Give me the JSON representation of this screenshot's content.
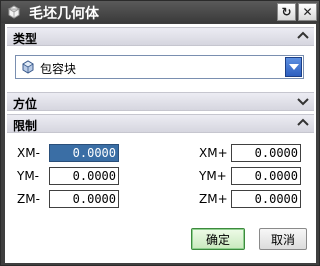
{
  "window": {
    "title": "毛坯几何体",
    "reset_glyph": "↻",
    "close_glyph": "✕"
  },
  "sections": {
    "type": {
      "label": "类型",
      "state": "expanded"
    },
    "orientation": {
      "label": "方位",
      "state": "collapsed"
    },
    "limits": {
      "label": "限制",
      "state": "expanded"
    }
  },
  "type_select": {
    "value": "包容块",
    "icon": "block-icon"
  },
  "limits": {
    "left": [
      {
        "label": "XM-",
        "value": "0.0000"
      },
      {
        "label": "YM-",
        "value": "0.0000"
      },
      {
        "label": "ZM-",
        "value": "0.0000"
      }
    ],
    "right": [
      {
        "label": "XM+",
        "value": "0.0000"
      },
      {
        "label": "YM+",
        "value": "0.0000"
      },
      {
        "label": "ZM+",
        "value": "0.0000"
      }
    ]
  },
  "footer": {
    "ok_label": "确定",
    "cancel_label": "取消"
  },
  "colors": {
    "title_bar": "#3f3f3f",
    "section_header": "#e2e2ea",
    "ok_border": "#3d8a3d",
    "focused_field": "#3a6ea5"
  }
}
